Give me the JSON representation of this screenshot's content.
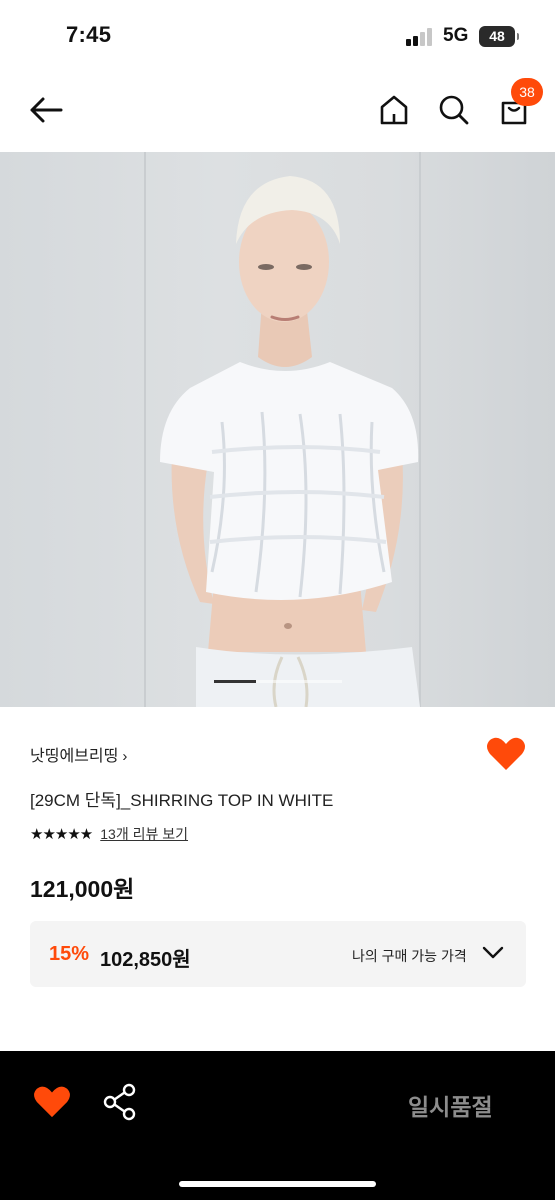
{
  "status_bar": {
    "time": "7:45",
    "network": "5G",
    "battery": "48"
  },
  "nav": {
    "cart_count": "38"
  },
  "product": {
    "brand": "낫띵에브리띵",
    "brand_chevron": "›",
    "title": "[29CM 단독]_SHIRRING TOP IN WHITE",
    "rating_stars": "★★★★★",
    "rating_value": 4.5,
    "review_link": "13개 리뷰 보기",
    "price": "121,000원",
    "discount_percent": "15%",
    "discounted_price": "102,850원",
    "my_price_label": "나의 구매 가능 가격",
    "liked": true
  },
  "image_gallery": {
    "current_index": 1,
    "total": 3
  },
  "bottom_bar": {
    "soldout_label": "일시품절"
  },
  "colors": {
    "accent": "#ff4a0a",
    "bottom_bar_bg": "#000000",
    "soldout_text": "#8d8d8d"
  },
  "icons": [
    "back-arrow-icon",
    "home-icon",
    "search-icon",
    "shopping-bag-icon",
    "chevron-right-icon",
    "heart-icon",
    "star-icon",
    "chevron-down-icon",
    "share-icon"
  ]
}
